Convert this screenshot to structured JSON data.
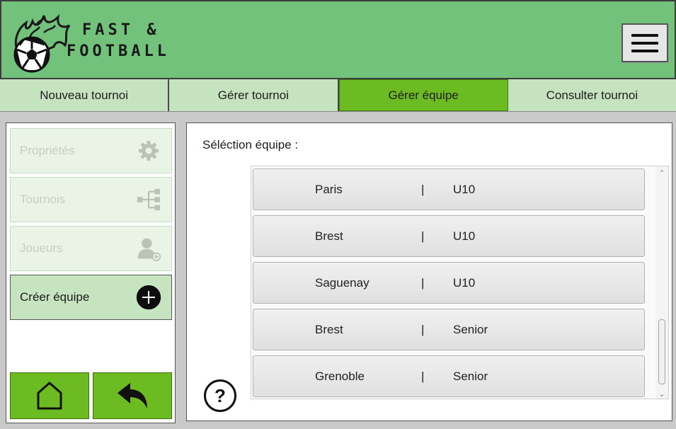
{
  "header": {
    "brand_line1": "FAST &",
    "brand_line2": "FOOTBALL",
    "logo_icon": "flaming-soccer-ball-icon",
    "menu_icon": "hamburger-menu-icon"
  },
  "tabs": [
    {
      "label": "Nouveau tournoi",
      "active": false
    },
    {
      "label": "Gérer tournoi",
      "active": false
    },
    {
      "label": "Gérer équipe",
      "active": true
    },
    {
      "label": "Consulter tournoi",
      "active": false
    }
  ],
  "sidebar": {
    "items": [
      {
        "label": "Propriétés",
        "icon": "gear-icon",
        "enabled": false
      },
      {
        "label": "Tournois",
        "icon": "bracket-tree-icon",
        "enabled": false
      },
      {
        "label": "Joueurs",
        "icon": "add-user-icon",
        "enabled": false
      },
      {
        "label": "Créer équipe",
        "icon": "plus-circle-icon",
        "enabled": true
      }
    ],
    "home_icon": "home-icon",
    "back_icon": "back-arrow-icon"
  },
  "main": {
    "selection_label": "Séléction équipe :",
    "separator": "|",
    "teams": [
      {
        "city": "Paris",
        "category": "U10"
      },
      {
        "city": "Brest",
        "category": "U10"
      },
      {
        "city": "Saguenay",
        "category": "U10"
      },
      {
        "city": "Brest",
        "category": "Senior"
      },
      {
        "city": "Grenoble",
        "category": "Senior"
      }
    ],
    "help_label": "?"
  },
  "colors": {
    "header_green": "#72c27c",
    "active_green": "#6dbb22",
    "tab_light_green": "#c6e3bf"
  }
}
